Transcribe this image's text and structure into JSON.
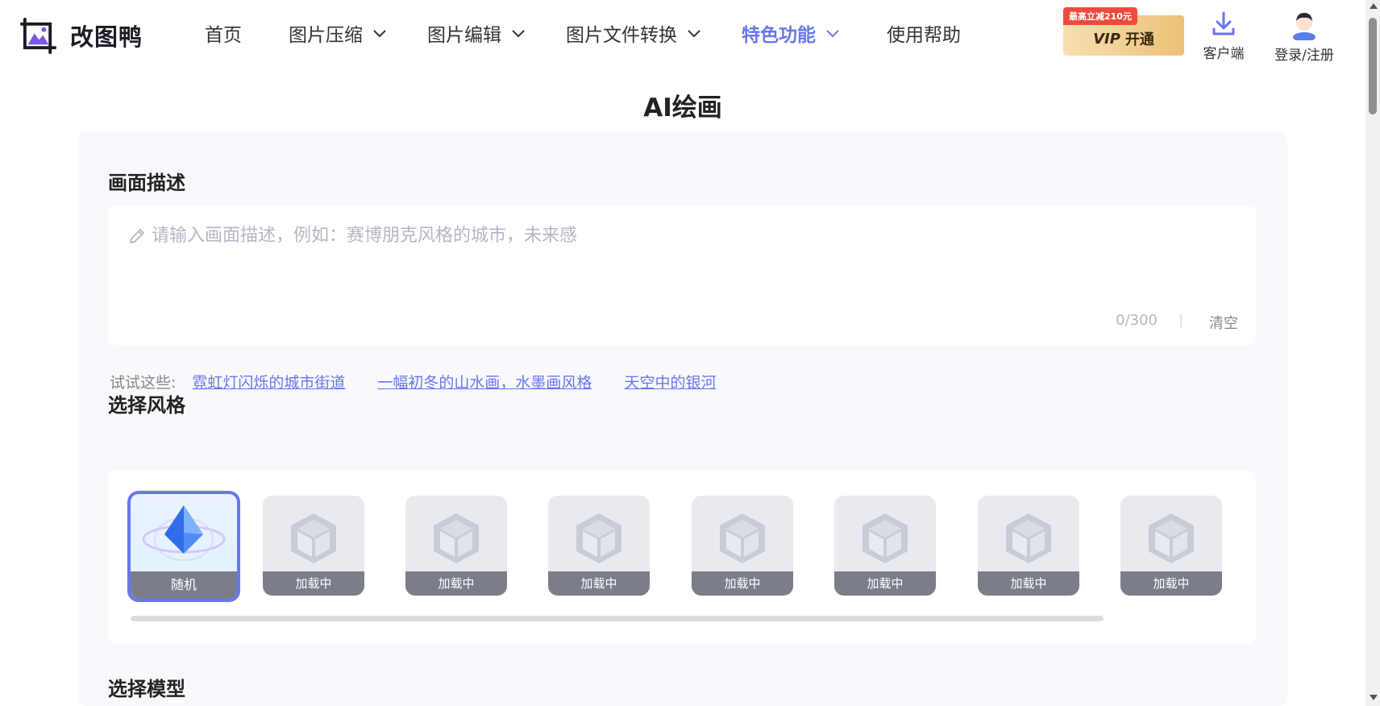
{
  "header": {
    "logo_text": "改图鸭",
    "nav": [
      {
        "label": "首页",
        "has_dropdown": false,
        "active": false
      },
      {
        "label": "图片压缩",
        "has_dropdown": true,
        "active": false
      },
      {
        "label": "图片编辑",
        "has_dropdown": true,
        "active": false
      },
      {
        "label": "图片文件转换",
        "has_dropdown": true,
        "active": false
      },
      {
        "label": "特色功能",
        "has_dropdown": true,
        "active": true
      },
      {
        "label": "使用帮助",
        "has_dropdown": false,
        "active": false
      }
    ],
    "vip_badge": "最高立减210元",
    "vip_prefix": "VIP",
    "vip_label": "开通",
    "client_label": "客户端",
    "login_label": "登录/注册"
  },
  "page": {
    "title": "AI绘画"
  },
  "description": {
    "section_title": "画面描述",
    "placeholder": "请输入画面描述，例如：赛博朋克风格的城市，未来感",
    "value": "",
    "counter": "0/300",
    "separator": "|",
    "clear_label": "清空"
  },
  "tries": {
    "label": "试试这些:",
    "links": [
      "霓虹灯闪烁的城市街道",
      "一幅初冬的山水画，水墨画风格",
      "天空中的银河"
    ]
  },
  "styles": {
    "section_title": "选择风格",
    "items": [
      "随机",
      "加载中",
      "加载中",
      "加载中",
      "加载中",
      "加载中",
      "加载中",
      "加载中"
    ]
  },
  "model": {
    "section_title": "选择模型"
  },
  "colors": {
    "accent": "#6777f0",
    "vip_gradient_start": "#f8dfb0",
    "vip_gradient_end": "#ebc177",
    "badge_red": "#f04a3d",
    "panel_bg": "#f9f9fd"
  }
}
